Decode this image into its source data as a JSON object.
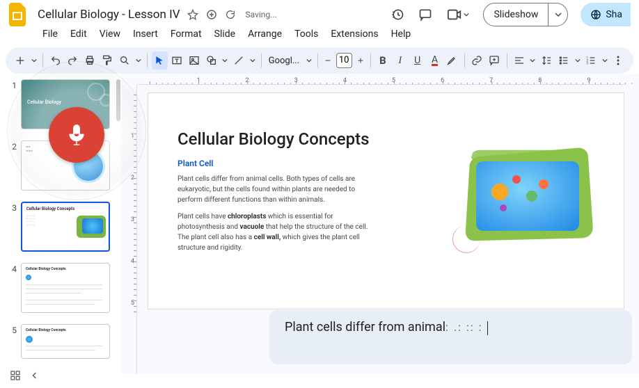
{
  "app": {
    "title": "Cellular Biology - Lesson IV",
    "saving_label": "Saving..."
  },
  "menu": {
    "file": "File",
    "edit": "Edit",
    "view": "View",
    "insert": "Insert",
    "format": "Format",
    "slide": "Slide",
    "arrange": "Arrange",
    "tools": "Tools",
    "extensions": "Extensions",
    "help": "Help"
  },
  "header_buttons": {
    "slideshow": "Slideshow",
    "share": "Sha"
  },
  "toolbar": {
    "font_name": "Googl...",
    "font_size": "10"
  },
  "ruler_h": [
    "1",
    "2",
    "3",
    "4",
    "5",
    "6",
    "7",
    "8",
    "9"
  ],
  "ruler_v": [
    "1",
    "2",
    "3",
    "4",
    "5"
  ],
  "thumbnails": {
    "t1": {
      "num": "1",
      "title": "Cellular Biology"
    },
    "t2": {
      "num": "2"
    },
    "t3": {
      "num": "3",
      "title": "Cellular Biology Concepts"
    },
    "t4": {
      "num": "4",
      "title": "Cellular Biology Concepts"
    },
    "t5": {
      "num": "5",
      "title": "Cellular Biology Concepts"
    }
  },
  "slide": {
    "title": "Cellular Biology Concepts",
    "subtitle": "Plant Cell",
    "para1": "Plant cells differ from animal cells. Both types of cells are eukaryotic, but the cells found within plants are needed to perform different functions than within animals.",
    "para2_pre": "Plant cells have ",
    "para2_b1": "chloroplasts",
    "para2_mid1": " which is essential for photosynthesis and ",
    "para2_b2": "vacuole",
    "para2_mid2": " that help the structure of the cell. The plant cell also has a ",
    "para2_b3": "cell wall,",
    "para2_post": " which gives the plant cell structure and rigidity."
  },
  "caption": {
    "text": "Plant cells differ from animal",
    "dots": " : .: :: :"
  }
}
